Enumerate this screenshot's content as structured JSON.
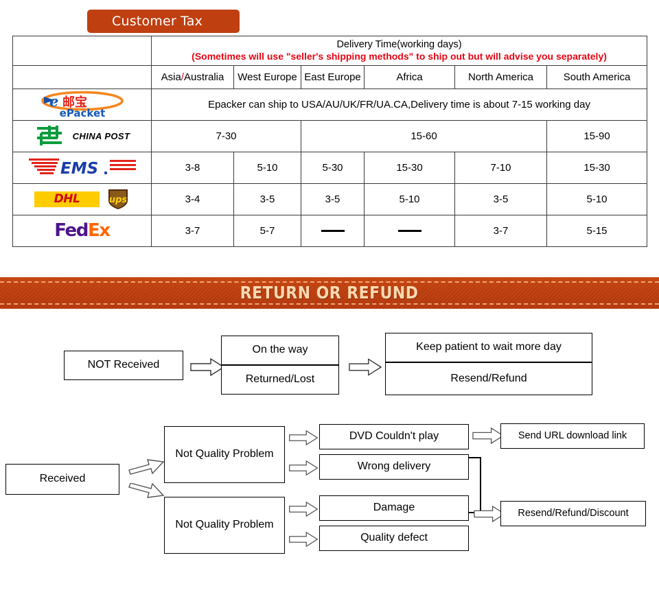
{
  "badge": {
    "label": "Customer Tax",
    "color": "#bf3f11"
  },
  "shipping_table": {
    "header": {
      "title": "Delivery Time(working days)",
      "note": "(Sometimes will use \"seller's shipping methods\" to ship out but will advise you separately)",
      "note_color": "#e30613"
    },
    "columns": [
      "",
      "Asia/Australia",
      "West Europe",
      "East Europe",
      "Africa",
      "North America",
      "South America"
    ],
    "rows": [
      {
        "carrier": "epacket-logo",
        "carrier_text": "ePacket",
        "span_note": "Epacker can ship to USA/AU/UK/FR/UA.CA,Delivery time is about 7-15 working day",
        "values": []
      },
      {
        "carrier": "china-post-logo",
        "carrier_text": "CHINA POST",
        "values": [
          "7-30",
          "15-60",
          "15-90"
        ],
        "spans": [
          2,
          3,
          1
        ]
      },
      {
        "carrier": "ems-logo",
        "carrier_text": "EMS",
        "values": [
          "3-8",
          "5-10",
          "5-30",
          "15-30",
          "7-10",
          "15-30"
        ]
      },
      {
        "carrier": "dhl-ups-logo",
        "carrier_text": "DHL UPS",
        "values": [
          "3-4",
          "3-5",
          "3-5",
          "5-10",
          "3-5",
          "5-10"
        ]
      },
      {
        "carrier": "fedex-logo",
        "carrier_text": "FedEx",
        "values": [
          "3-7",
          "5-7",
          "—",
          "—",
          "3-7",
          "5-15"
        ]
      }
    ]
  },
  "return_banner": {
    "title": "RETURN OR REFUND",
    "bg_color": "#bd3d0d",
    "text_color": "#fbd9b0"
  },
  "flow_not_received": {
    "start": "NOT Received",
    "middle": [
      "On the way",
      "Returned/Lost"
    ],
    "end": [
      "Keep patient to wait more day",
      "Resend/Refund"
    ]
  },
  "flow_received": {
    "start": "Received",
    "middle": [
      "Not Quality Problem",
      "Not Quality Problem"
    ],
    "issues": [
      "DVD Couldn't play",
      "Wrong delivery",
      "Damage",
      "Quality defect"
    ],
    "outcomes": [
      "Send URL download link",
      "Resend/Refund/Discount"
    ]
  }
}
